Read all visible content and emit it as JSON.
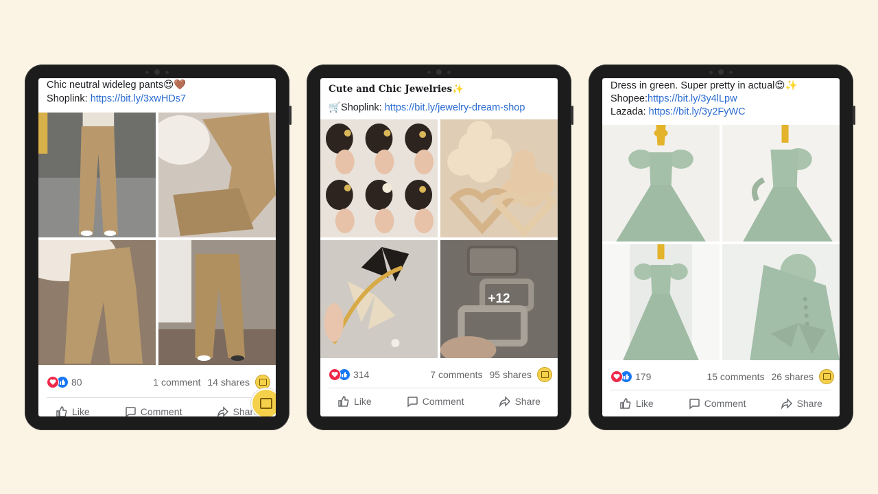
{
  "posts": [
    {
      "caption_line1": "Chic neutral wideleg pants😍🤎",
      "caption_label": "Shoplink: ",
      "caption_link": "https://bit.ly/3xwHDs7",
      "reactions": "80",
      "comments": "1 comment",
      "shares": "14 shares",
      "like": "Like",
      "comment": "Comment",
      "share": "Share"
    },
    {
      "caption_line1": "Cute and Chic Jewelries✨",
      "caption_label": "🛒Shoplink: ",
      "caption_link": "https://bit.ly/jewelry-dream-shop",
      "more_photos": "+12",
      "reactions": "314",
      "comments": "7 comments",
      "shares": "95 shares",
      "like": "Like",
      "comment": "Comment",
      "share": "Share"
    },
    {
      "caption_line1": "Dress in green. Super pretty in actual😍✨",
      "caption_label2": "Shopee:",
      "caption_link2": "https://bit.ly/3y4lLpw",
      "caption_label3": "Lazada: ",
      "caption_link3": "https://bit.ly/3y2FyWC",
      "reactions": "179",
      "comments": "15 comments",
      "shares": "26 shares",
      "like": "Like",
      "comment": "Comment",
      "share": "Share"
    }
  ],
  "colors": {
    "background": "#fbf3e4",
    "link": "#2a6bd1",
    "pants": "#b9996c",
    "jewelry": "#d8c2a0",
    "dress": "#a9c3ad"
  }
}
